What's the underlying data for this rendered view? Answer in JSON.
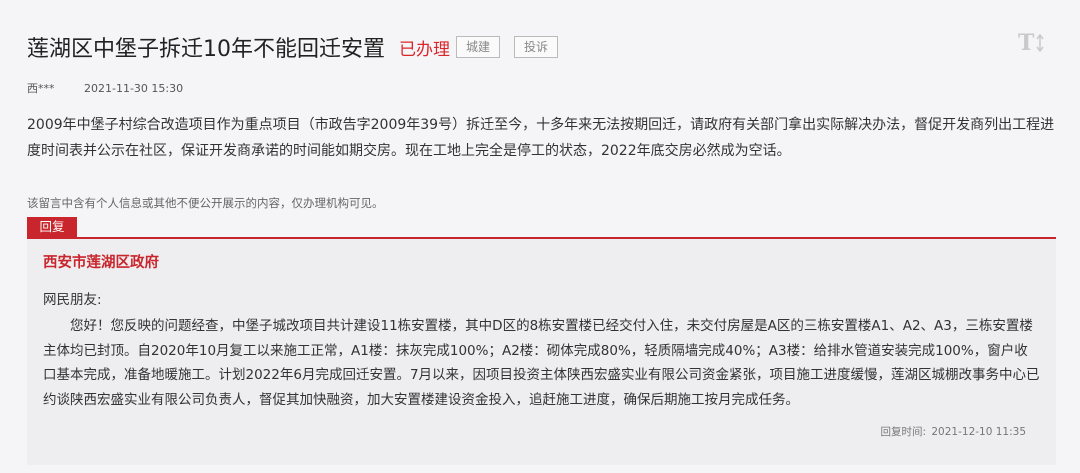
{
  "post": {
    "title": "莲湖区中堡子拆迁10年不能回迁安置",
    "status": "已办理",
    "tags": [
      "城建",
      "投诉"
    ],
    "author": "西***",
    "date": "2021-11-30 15:30",
    "content": "2009年中堡子村综合改造项目作为重点项目（市政告字2009年39号）拆迁至今，十多年来无法按期回迁，请政府有关部门拿出实际解决办法，督促开发商列出工程进度时间表并公示在社区，保证开发商承诺的时间能如期交房。现在工地上完全是停工的状态，2022年底交房必然成为空话。",
    "notice": "该留言中含有个人信息或其他不便公开展示的内容，仅办理机构可见。"
  },
  "reply": {
    "tab_label": "回复",
    "org": "西安市莲湖区政府",
    "greeting": "网民朋友:",
    "content": "您好！您反映的问题经查，中堡子城改项目共计建设11栋安置楼，其中D区的8栋安置楼已经交付入住，未交付房屋是A区的三栋安置楼A1、A2、A3，三栋安置楼主体均已封顶。自2020年10月复工以来施工正常，A1楼：抹灰完成100%；A2楼：砌体完成80%，轻质隔墙完成40%；A3楼：给排水管道安装完成100%，窗户收口基本完成，准备地暖施工。计划2022年6月完成回迁安置。7月以来，因项目投资主体陕西宏盛实业有限公司资金紧张，项目施工进度缓慢，莲湖区城棚改事务中心已约谈陕西宏盛实业有限公司负责人，督促其加快融资，加大安置楼建设资金投入，追赶施工进度，确保后期施工按月完成任务。",
    "time_label": "回复时间:",
    "time": "2021-12-10 11:35"
  },
  "icons": {
    "font_size": "text-size-icon"
  },
  "colors": {
    "accent": "#c8262c",
    "status": "#d9262b",
    "reply_bg": "#eeeef0",
    "page_bg": "#f5f5f7"
  }
}
